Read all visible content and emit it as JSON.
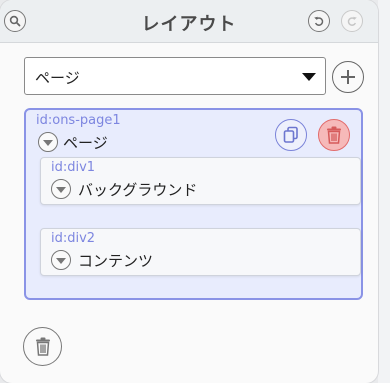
{
  "header": {
    "title": "レイアウト",
    "search_icon": "search-icon",
    "undo_icon": "undo-icon",
    "redo_icon": "redo-icon"
  },
  "page_select": {
    "value": "ページ",
    "icon": "chevron-down-icon"
  },
  "add_button": {
    "icon": "plus-icon"
  },
  "tree": {
    "root": {
      "id": "id:ons-page1",
      "label": "ページ",
      "copy_icon": "copy-icon",
      "delete_icon": "trash-icon"
    },
    "children": [
      {
        "id": "id:div1",
        "label": "バックグラウンド"
      },
      {
        "id": "id:div2",
        "label": "コンテンツ"
      }
    ]
  },
  "footer": {
    "delete_icon": "trash-icon"
  },
  "colors": {
    "accent": "#8a93e6",
    "tree_bg": "#e8ecfd",
    "danger": "#e26b6b",
    "danger_bg": "#f6b9b9"
  }
}
